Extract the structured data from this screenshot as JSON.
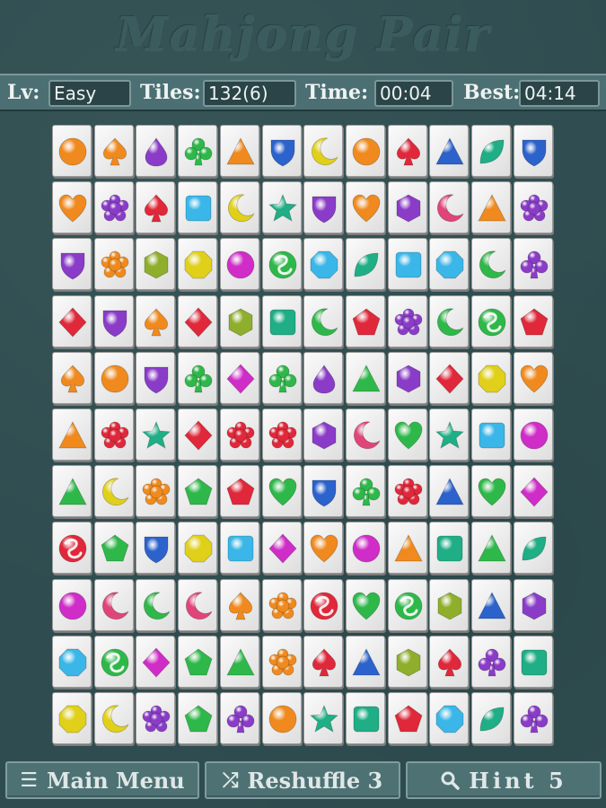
{
  "title": "Mahjong Pair",
  "status": {
    "level_label": "Lv:",
    "level_value": "Easy",
    "tiles_label": "Tiles:",
    "tiles_value": "132(6)",
    "time_label": "Time:",
    "time_value": "00:04",
    "best_label": "Best:",
    "best_value": "04:14"
  },
  "buttons": {
    "main_menu": "Main Menu",
    "reshuffle": "Reshuffle 3",
    "hint": "Hint 5"
  },
  "colors": {
    "orange": "#f08a1e",
    "red": "#e0283a",
    "purple": "#8a3cc8",
    "green": "#2fb84a",
    "blue": "#2c62cc",
    "cyan": "#3ab7e8",
    "teal": "#1fae86",
    "pink": "#e0457a",
    "yellow": "#e0d01a",
    "magenta": "#d02cc8",
    "olive": "#8fae2c"
  },
  "board": [
    [
      [
        "circle",
        "orange"
      ],
      [
        "spade",
        "orange"
      ],
      [
        "drop",
        "purple"
      ],
      [
        "club",
        "green"
      ],
      [
        "triangle",
        "orange"
      ],
      [
        "shield",
        "blue"
      ],
      [
        "moon",
        "yellow"
      ],
      [
        "circle",
        "orange"
      ],
      [
        "spade",
        "red"
      ],
      [
        "triangle",
        "blue"
      ],
      [
        "leaf",
        "teal"
      ],
      [
        "shield",
        "blue"
      ]
    ],
    [
      [
        "heart",
        "orange"
      ],
      [
        "flower",
        "purple"
      ],
      [
        "spade",
        "red"
      ],
      [
        "square",
        "cyan"
      ],
      [
        "moon",
        "yellow"
      ],
      [
        "star",
        "teal"
      ],
      [
        "shield",
        "purple"
      ],
      [
        "heart",
        "orange"
      ],
      [
        "hexagon",
        "purple"
      ],
      [
        "moon",
        "pink"
      ],
      [
        "triangle",
        "orange"
      ],
      [
        "flower",
        "purple"
      ]
    ],
    [
      [
        "shield",
        "purple"
      ],
      [
        "flower",
        "orange"
      ],
      [
        "hexagon",
        "olive"
      ],
      [
        "octagon",
        "yellow"
      ],
      [
        "circle",
        "magenta"
      ],
      [
        "swirl",
        "green"
      ],
      [
        "octagon",
        "cyan"
      ],
      [
        "leaf",
        "teal"
      ],
      [
        "square",
        "cyan"
      ],
      [
        "octagon",
        "cyan"
      ],
      [
        "moon",
        "green"
      ],
      [
        "club",
        "purple"
      ]
    ],
    [
      [
        "diamond",
        "red"
      ],
      [
        "shield",
        "purple"
      ],
      [
        "spade",
        "orange"
      ],
      [
        "diamond",
        "red"
      ],
      [
        "hexagon",
        "olive"
      ],
      [
        "square",
        "teal"
      ],
      [
        "moon",
        "green"
      ],
      [
        "pentagon",
        "red"
      ],
      [
        "flower",
        "purple"
      ],
      [
        "moon",
        "green"
      ],
      [
        "swirl",
        "green"
      ],
      [
        "pentagon",
        "red"
      ]
    ],
    [
      [
        "spade",
        "orange"
      ],
      [
        "circle",
        "orange"
      ],
      [
        "shield",
        "purple"
      ],
      [
        "club",
        "green"
      ],
      [
        "diamond",
        "magenta"
      ],
      [
        "club",
        "green"
      ],
      [
        "drop",
        "purple"
      ],
      [
        "triangle",
        "green"
      ],
      [
        "hexagon",
        "purple"
      ],
      [
        "diamond",
        "red"
      ],
      [
        "octagon",
        "yellow"
      ],
      [
        "heart",
        "orange"
      ]
    ],
    [
      [
        "triangle",
        "orange"
      ],
      [
        "flower",
        "red"
      ],
      [
        "star",
        "teal"
      ],
      [
        "diamond",
        "red"
      ],
      [
        "flower",
        "red"
      ],
      [
        "flower",
        "red"
      ],
      [
        "hexagon",
        "purple"
      ],
      [
        "moon",
        "pink"
      ],
      [
        "heart",
        "green"
      ],
      [
        "star",
        "teal"
      ],
      [
        "square",
        "cyan"
      ],
      [
        "circle",
        "magenta"
      ]
    ],
    [
      [
        "triangle",
        "green"
      ],
      [
        "moon",
        "yellow"
      ],
      [
        "flower",
        "orange"
      ],
      [
        "pentagon",
        "green"
      ],
      [
        "pentagon",
        "red"
      ],
      [
        "heart",
        "green"
      ],
      [
        "shield",
        "blue"
      ],
      [
        "club",
        "green"
      ],
      [
        "flower",
        "red"
      ],
      [
        "triangle",
        "blue"
      ],
      [
        "heart",
        "green"
      ],
      [
        "diamond",
        "magenta"
      ]
    ],
    [
      [
        "swirl",
        "red"
      ],
      [
        "pentagon",
        "green"
      ],
      [
        "shield",
        "blue"
      ],
      [
        "octagon",
        "yellow"
      ],
      [
        "square",
        "cyan"
      ],
      [
        "diamond",
        "magenta"
      ],
      [
        "heart",
        "orange"
      ],
      [
        "circle",
        "magenta"
      ],
      [
        "triangle",
        "orange"
      ],
      [
        "square",
        "teal"
      ],
      [
        "triangle",
        "green"
      ],
      [
        "leaf",
        "teal"
      ]
    ],
    [
      [
        "circle",
        "magenta"
      ],
      [
        "moon",
        "pink"
      ],
      [
        "moon",
        "green"
      ],
      [
        "moon",
        "pink"
      ],
      [
        "spade",
        "orange"
      ],
      [
        "flower",
        "orange"
      ],
      [
        "swirl",
        "red"
      ],
      [
        "heart",
        "green"
      ],
      [
        "swirl",
        "green"
      ],
      [
        "hexagon",
        "olive"
      ],
      [
        "triangle",
        "blue"
      ],
      [
        "hexagon",
        "purple"
      ]
    ],
    [
      [
        "octagon",
        "cyan"
      ],
      [
        "swirl",
        "green"
      ],
      [
        "diamond",
        "magenta"
      ],
      [
        "pentagon",
        "green"
      ],
      [
        "triangle",
        "green"
      ],
      [
        "flower",
        "orange"
      ],
      [
        "spade",
        "red"
      ],
      [
        "triangle",
        "blue"
      ],
      [
        "hexagon",
        "olive"
      ],
      [
        "spade",
        "red"
      ],
      [
        "club",
        "purple"
      ],
      [
        "square",
        "teal"
      ]
    ],
    [
      [
        "octagon",
        "yellow"
      ],
      [
        "moon",
        "yellow"
      ],
      [
        "flower",
        "purple"
      ],
      [
        "pentagon",
        "green"
      ],
      [
        "club",
        "purple"
      ],
      [
        "circle",
        "orange"
      ],
      [
        "star",
        "teal"
      ],
      [
        "square",
        "teal"
      ],
      [
        "pentagon",
        "red"
      ],
      [
        "octagon",
        "cyan"
      ],
      [
        "leaf",
        "teal"
      ],
      [
        "club",
        "purple"
      ]
    ]
  ]
}
